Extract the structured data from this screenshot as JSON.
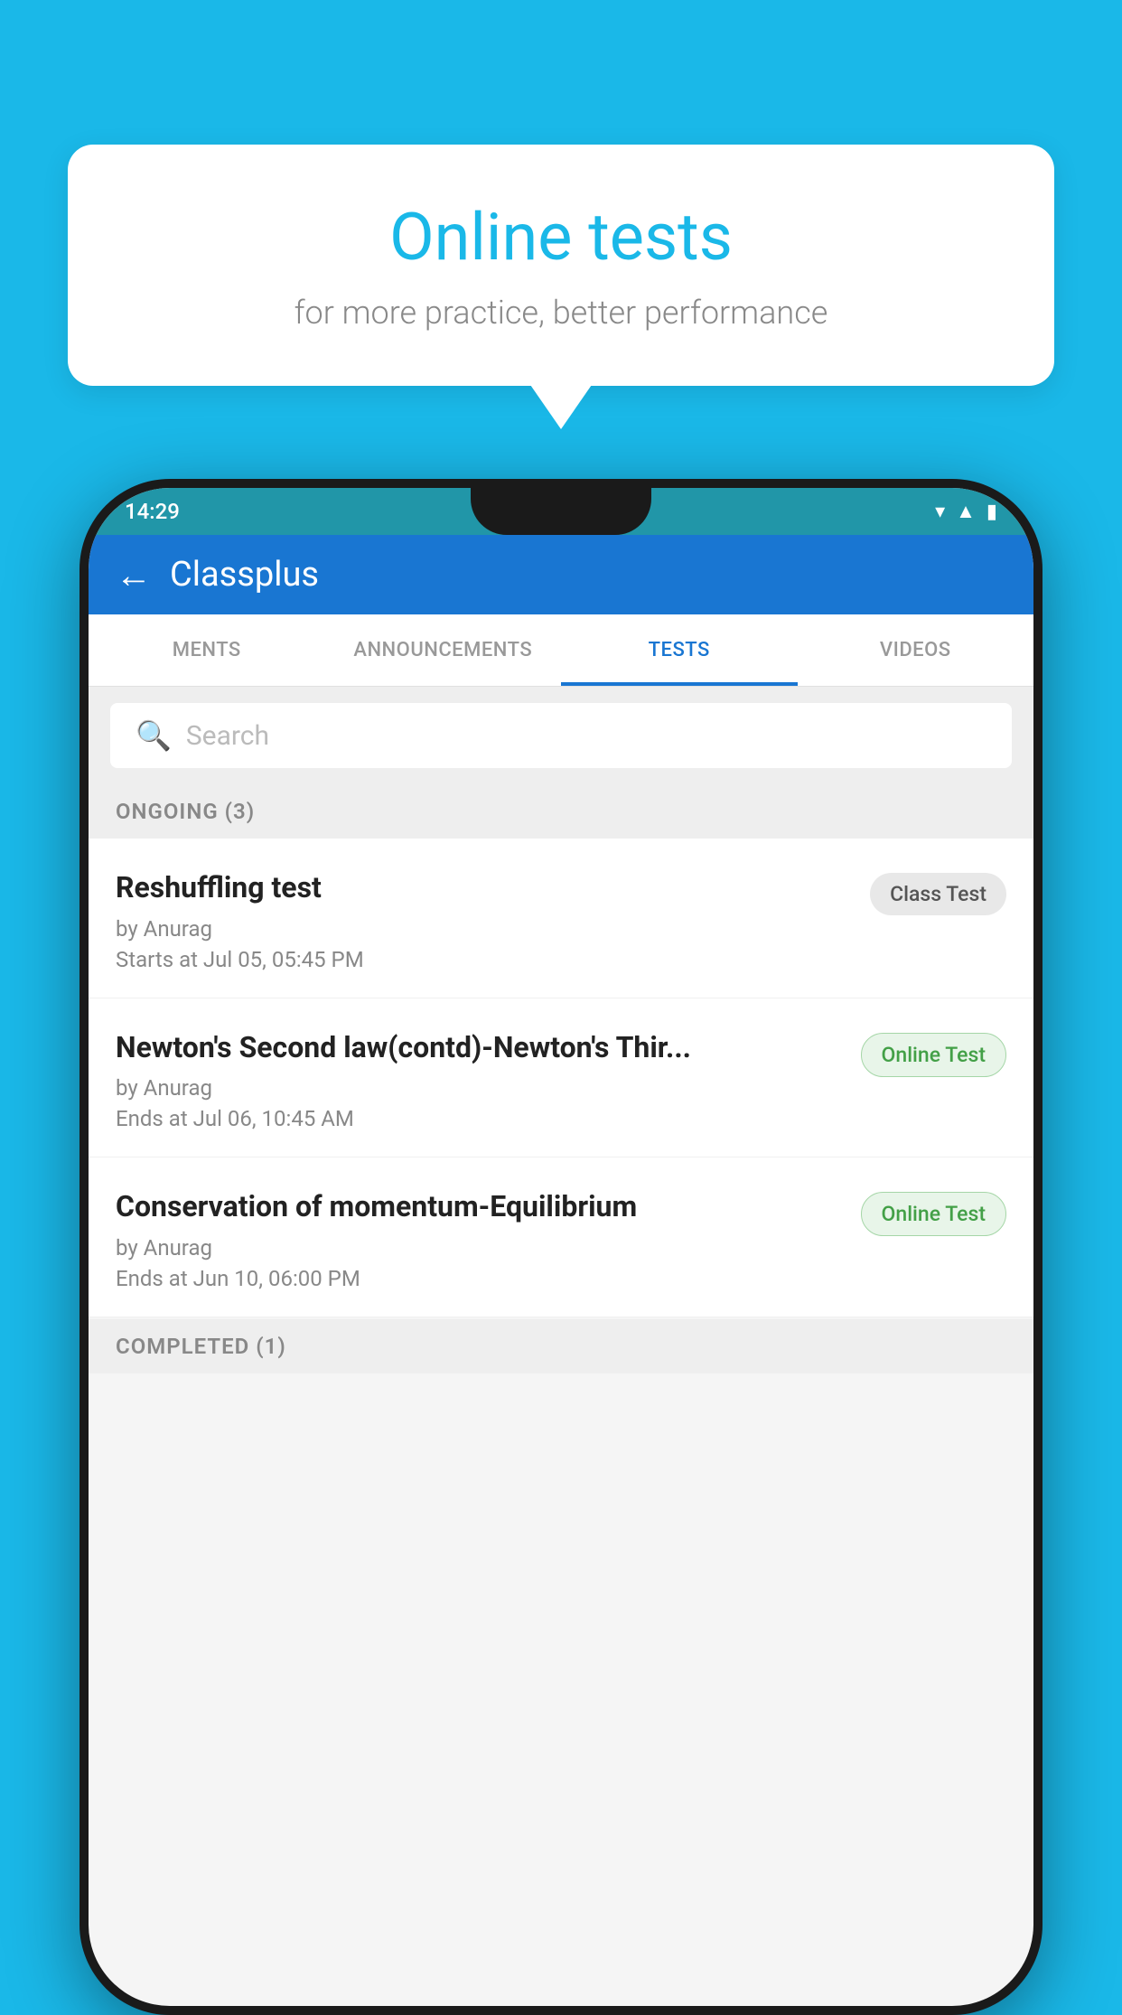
{
  "background": {
    "color": "#1ab8e8"
  },
  "speech_bubble": {
    "title": "Online tests",
    "subtitle": "for more practice, better performance"
  },
  "phone": {
    "status_bar": {
      "time": "14:29",
      "icons": [
        "wifi",
        "signal",
        "battery"
      ]
    },
    "app_bar": {
      "back_label": "←",
      "title": "Classplus"
    },
    "tabs": [
      {
        "label": "MENTS",
        "active": false
      },
      {
        "label": "ANNOUNCEMENTS",
        "active": false
      },
      {
        "label": "TESTS",
        "active": true
      },
      {
        "label": "VIDEOS",
        "active": false
      }
    ],
    "search": {
      "placeholder": "Search"
    },
    "sections": [
      {
        "label": "ONGOING (3)",
        "tests": [
          {
            "name": "Reshuffling test",
            "by": "by Anurag",
            "date": "Starts at  Jul 05, 05:45 PM",
            "badge": "Class Test",
            "badge_type": "class"
          },
          {
            "name": "Newton's Second law(contd)-Newton's Thir...",
            "by": "by Anurag",
            "date": "Ends at  Jul 06, 10:45 AM",
            "badge": "Online Test",
            "badge_type": "online"
          },
          {
            "name": "Conservation of momentum-Equilibrium",
            "by": "by Anurag",
            "date": "Ends at  Jun 10, 06:00 PM",
            "badge": "Online Test",
            "badge_type": "online"
          }
        ]
      }
    ],
    "bottom_section": {
      "label": "COMPLETED (1)"
    }
  }
}
